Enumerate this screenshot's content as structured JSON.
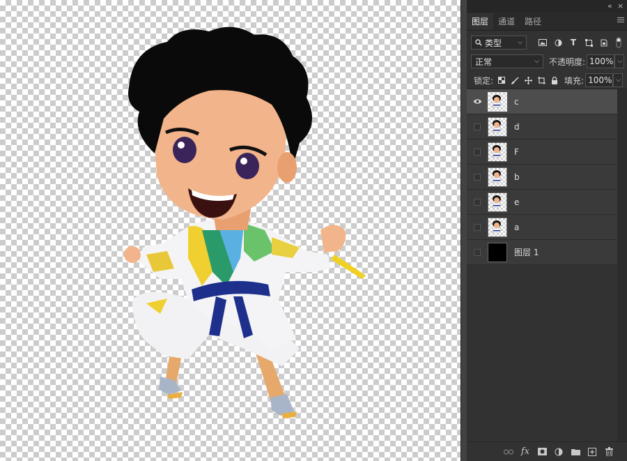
{
  "panel": {
    "tabs": [
      {
        "label": "图层"
      },
      {
        "label": "通道"
      },
      {
        "label": "路径"
      }
    ],
    "filter": {
      "label": "类型"
    },
    "blend": {
      "mode": "正常",
      "opacity_label": "不透明度:",
      "opacity_value": "100%"
    },
    "lock": {
      "label": "锁定:",
      "fill_label": "填充:",
      "fill_value": "100%"
    },
    "layers": [
      {
        "name": "c",
        "visible": true,
        "selected": true
      },
      {
        "name": "d",
        "visible": false,
        "selected": false
      },
      {
        "name": "F",
        "visible": false,
        "selected": false
      },
      {
        "name": "b",
        "visible": false,
        "selected": false
      },
      {
        "name": "e",
        "visible": false,
        "selected": false
      },
      {
        "name": "a",
        "visible": false,
        "selected": false
      },
      {
        "name": "图层 1",
        "visible": false,
        "selected": false
      }
    ]
  },
  "colors": {
    "panel_bg": "#323232",
    "selected_layer": "#4d4d4d",
    "belt": "#1e2f8c"
  }
}
